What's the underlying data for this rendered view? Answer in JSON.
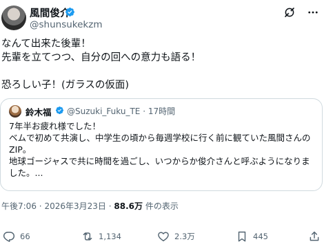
{
  "author": {
    "display_name": "風間俊介",
    "handle": "@shunsukekzm"
  },
  "post": {
    "lines": [
      "なんて出来た後輩！",
      "先輩を立てつつ、自分の回への意力も語る！",
      "",
      "恐ろしい子！(ガラスの仮面)"
    ],
    "time": "午後7:06",
    "date": "2026年3月23日",
    "separator": "·",
    "views_count": "88.6万",
    "views_label": "件の表示"
  },
  "quote": {
    "display_name": "鈴木福",
    "handle": "@Suzuki_Fuku_TE",
    "separator": "·",
    "time_ago": "17時間",
    "lines": [
      "7年半お疲れ様でした！",
      "ベムで初めて共演し、中学生の頃から毎週学校に行く前に観ていた風間さんの",
      "ZIP。",
      "地球ゴージャスで共に時間を過ごし、いつからか俊介さんと呼ぶようになりま",
      "した。..."
    ]
  },
  "actions": {
    "replies": "66",
    "reposts": "1,134",
    "likes": "2.3万",
    "bookmarks": "445"
  },
  "icons": {
    "verified": "verified-badge-icon",
    "grok": "grok-icon",
    "more": "more-icon",
    "reply": "reply-icon",
    "repost": "repost-icon",
    "like": "heart-icon",
    "bookmark": "bookmark-icon",
    "share": "share-icon"
  },
  "colors": {
    "verified_blue": "#1d9bf0",
    "text": "#0f1419",
    "secondary": "#536471",
    "border": "#cfd9de"
  }
}
